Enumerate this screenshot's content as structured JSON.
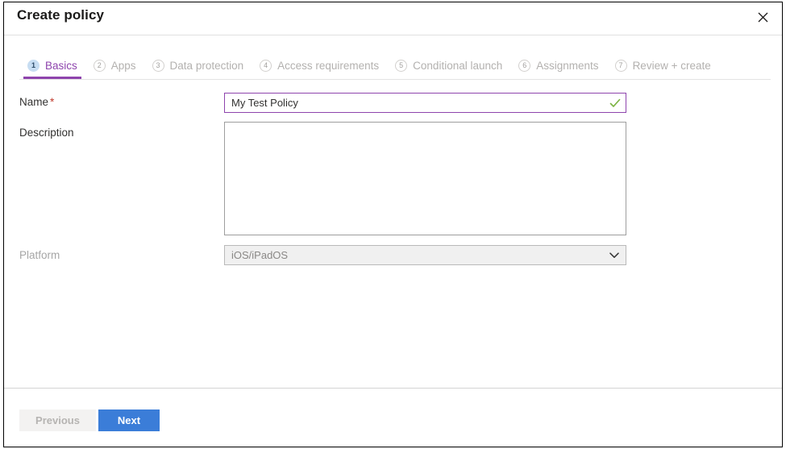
{
  "header": {
    "title": "Create policy",
    "close_icon": "close-icon"
  },
  "tabs": [
    {
      "number": "1",
      "label": "Basics",
      "state": "active"
    },
    {
      "number": "2",
      "label": "Apps",
      "state": "inactive"
    },
    {
      "number": "3",
      "label": "Data protection",
      "state": "inactive"
    },
    {
      "number": "4",
      "label": "Access requirements",
      "state": "inactive"
    },
    {
      "number": "5",
      "label": "Conditional launch",
      "state": "inactive"
    },
    {
      "number": "6",
      "label": "Assignments",
      "state": "inactive"
    },
    {
      "number": "7",
      "label": "Review + create",
      "state": "inactive"
    }
  ],
  "form": {
    "name": {
      "label": "Name",
      "required_marker": "*",
      "value": "My Test Policy",
      "placeholder": "",
      "valid_icon": "checkmark-icon",
      "valid_color": "#7cb342",
      "border_color": "#8e44ad"
    },
    "description": {
      "label": "Description",
      "value": "",
      "placeholder": ""
    },
    "platform": {
      "label": "Platform",
      "selected": "iOS/iPadOS",
      "chevron_icon": "chevron-down-icon",
      "disabled": "true"
    }
  },
  "footer": {
    "previous_label": "Previous",
    "next_label": "Next",
    "next_color": "#3b7dd8"
  },
  "colors": {
    "accent_purple": "#8e44ad",
    "primary_blue": "#3b7dd8",
    "required_red": "#c0392b",
    "success_green": "#7cb342"
  }
}
